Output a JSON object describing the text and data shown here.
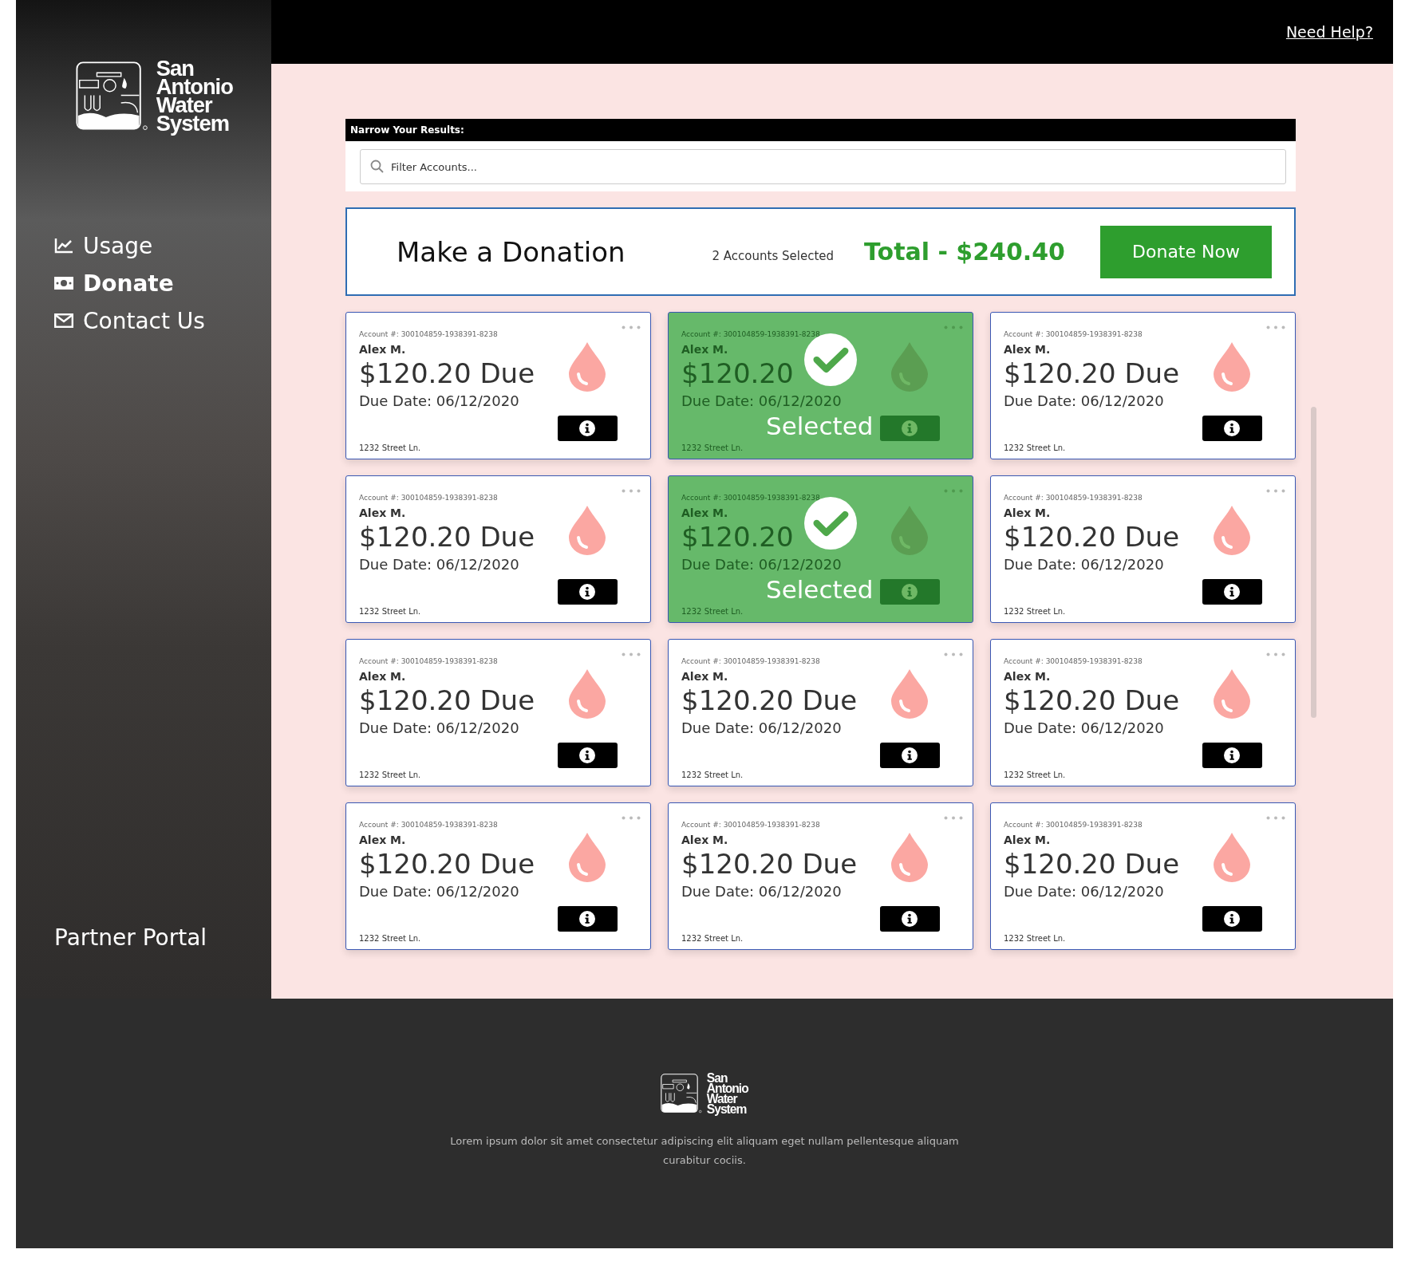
{
  "header": {
    "help_link": "Need Help?"
  },
  "logo": {
    "lines": [
      "San",
      "Antonio",
      "Water",
      "System"
    ]
  },
  "nav": [
    {
      "label": "Usage",
      "selected": false
    },
    {
      "label": "Donate",
      "selected": true
    },
    {
      "label": "Contact Us",
      "selected": false
    }
  ],
  "sidebar_footer": "Partner Portal",
  "filter": {
    "title": "Narrow Your Results:",
    "placeholder": "Filter Accounts..."
  },
  "donation": {
    "title": "Make a Donation",
    "selected_count": "2 Accounts Selected",
    "total": "Total - $240.40",
    "button": "Donate Now"
  },
  "accounts": [
    {
      "account": "Account #: 300104859-1938391-8238",
      "name": "Alex M.",
      "amount": "$120.20 Due",
      "due_date": "Due Date: 06/12/2020",
      "address": "1232 Street Ln.",
      "selected": false
    },
    {
      "account": "Account #: 300104859-1938391-8238",
      "name": "Alex M.",
      "amount": "$120.20",
      "due_date": "Due Date: 06/12/2020",
      "address": "1232 Street Ln.",
      "selected": true,
      "overlay_label": "Selected"
    },
    {
      "account": "Account #: 300104859-1938391-8238",
      "name": "Alex M.",
      "amount": "$120.20 Due",
      "due_date": "Due Date: 06/12/2020",
      "address": "1232 Street Ln.",
      "selected": false
    },
    {
      "account": "Account #: 300104859-1938391-8238",
      "name": "Alex M.",
      "amount": "$120.20 Due",
      "due_date": "Due Date: 06/12/2020",
      "address": "1232 Street Ln.",
      "selected": false
    },
    {
      "account": "Account #: 300104859-1938391-8238",
      "name": "Alex M.",
      "amount": "$120.20",
      "due_date": "Due Date: 06/12/2020",
      "address": "1232 Street Ln.",
      "selected": true,
      "overlay_label": "Selected"
    },
    {
      "account": "Account #: 300104859-1938391-8238",
      "name": "Alex M.",
      "amount": "$120.20 Due",
      "due_date": "Due Date: 06/12/2020",
      "address": "1232 Street Ln.",
      "selected": false
    },
    {
      "account": "Account #: 300104859-1938391-8238",
      "name": "Alex M.",
      "amount": "$120.20 Due",
      "due_date": "Due Date: 06/12/2020",
      "address": "1232 Street Ln.",
      "selected": false
    },
    {
      "account": "Account #: 300104859-1938391-8238",
      "name": "Alex M.",
      "amount": "$120.20 Due",
      "due_date": "Due Date: 06/12/2020",
      "address": "1232 Street Ln.",
      "selected": false
    },
    {
      "account": "Account #: 300104859-1938391-8238",
      "name": "Alex M.",
      "amount": "$120.20 Due",
      "due_date": "Due Date: 06/12/2020",
      "address": "1232 Street Ln.",
      "selected": false
    },
    {
      "account": "Account #: 300104859-1938391-8238",
      "name": "Alex M.",
      "amount": "$120.20 Due",
      "due_date": "Due Date: 06/12/2020",
      "address": "1232 Street Ln.",
      "selected": false
    },
    {
      "account": "Account #: 300104859-1938391-8238",
      "name": "Alex M.",
      "amount": "$120.20 Due",
      "due_date": "Due Date: 06/12/2020",
      "address": "1232 Street Ln.",
      "selected": false
    },
    {
      "account": "Account #: 300104859-1938391-8238",
      "name": "Alex M.",
      "amount": "$120.20 Due",
      "due_date": "Due Date: 06/12/2020",
      "address": "1232 Street Ln.",
      "selected": false
    }
  ],
  "footer": {
    "logo_lines": [
      "San",
      "Antonio",
      "Water",
      "System"
    ],
    "text": "Lorem ipsum dolor sit amet consectetur adipiscing elit aliquam eget nullam pellentesque aliquam curabitur cociis."
  }
}
